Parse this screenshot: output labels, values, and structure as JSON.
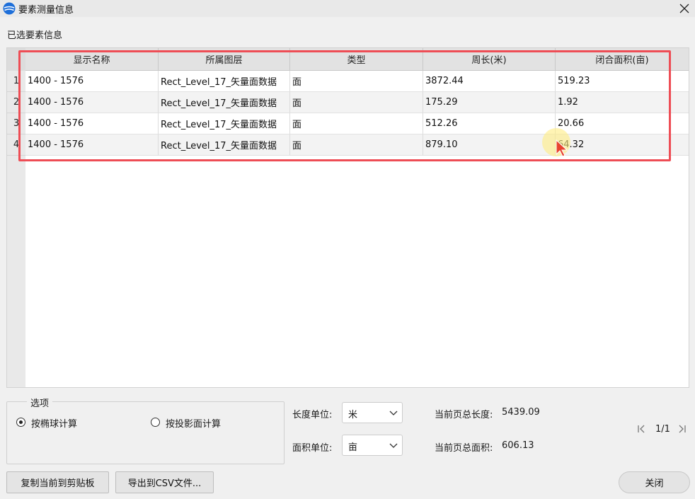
{
  "window": {
    "title": "要素测量信息",
    "close_icon": "close-icon"
  },
  "section": {
    "label": "已选要素信息"
  },
  "table": {
    "columns": [
      "显示名称",
      "所属图层",
      "类型",
      "周长(米)",
      "闭合面积(亩)"
    ],
    "rows": [
      {
        "num": "1",
        "name": "1400 - 1576",
        "layer": "Rect_Level_17_矢量面数据",
        "type": "面",
        "perimeter": "3872.44",
        "area": "519.23"
      },
      {
        "num": "2",
        "name": "1400 - 1576",
        "layer": "Rect_Level_17_矢量面数据",
        "type": "面",
        "perimeter": "175.29",
        "area": "1.92"
      },
      {
        "num": "3",
        "name": "1400 - 1576",
        "layer": "Rect_Level_17_矢量面数据",
        "type": "面",
        "perimeter": "512.26",
        "area": "20.66"
      },
      {
        "num": "4",
        "name": "1400 - 1576",
        "layer": "Rect_Level_17_矢量面数据",
        "type": "面",
        "perimeter": "879.10",
        "area": "64.32"
      }
    ]
  },
  "options": {
    "legend": "选项",
    "ellipsoid_label": "按椭球计算",
    "projection_label": "按投影面计算",
    "selected": "ellipsoid"
  },
  "units": {
    "length_label": "长度单位:",
    "length_value": "米",
    "area_label": "面积单位:",
    "area_value": "亩"
  },
  "totals": {
    "length_label": "当前页总长度:",
    "length_value": "5439.09",
    "area_label": "当前页总面积:",
    "area_value": "606.13"
  },
  "pager": {
    "text": "1/1"
  },
  "buttons": {
    "copy": "复制当前到剪贴板",
    "export": "导出到CSV文件...",
    "close": "关闭"
  },
  "colors": {
    "annotation": "#ee4d55",
    "app_icon": "#1e6fd9"
  }
}
